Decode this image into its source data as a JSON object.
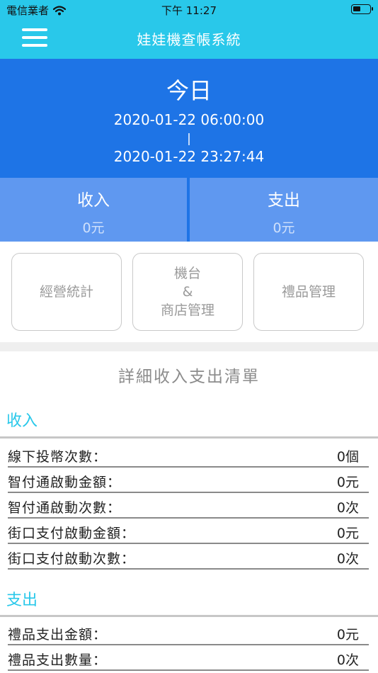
{
  "status_bar": {
    "carrier": "電信業者",
    "time": "下午 11:27",
    "icons": [
      "wifi-icon",
      "battery-icon"
    ]
  },
  "nav": {
    "title": "娃娃機查帳系統",
    "menu_icon": "hamburger-menu-icon"
  },
  "colors": {
    "topbar": "#29c8ea",
    "hero": "#1e74e6",
    "summary_cell": "#5f98f0",
    "section_title": "#29c8ea"
  },
  "period": {
    "label": "今日",
    "start": "2020-01-22 06:00:00",
    "separator": "|",
    "end": "2020-01-22 23:27:44"
  },
  "summary": {
    "income_label": "收入",
    "income_value": "0元",
    "expense_label": "支出",
    "expense_value": "0元"
  },
  "tiles": {
    "stats": "經營統計",
    "machine_line1": "機台",
    "machine_line2": "&",
    "machine_line3": "商店管理",
    "gifts": "禮品管理"
  },
  "detail": {
    "title": "詳細收入支出清單",
    "income": {
      "title": "收入",
      "items": [
        {
          "label": "線下投幣次數：",
          "value": "0個"
        },
        {
          "label": "智付通啟動金額：",
          "value": "0元"
        },
        {
          "label": "智付通啟動次數：",
          "value": "0次"
        },
        {
          "label": "街口支付啟動金額：",
          "value": "0元"
        },
        {
          "label": "街口支付啟動次數：",
          "value": "0次"
        }
      ]
    },
    "expense": {
      "title": "支出",
      "items": [
        {
          "label": "禮品支出金額：",
          "value": "0元"
        },
        {
          "label": "禮品支出數量：",
          "value": "0次"
        }
      ]
    }
  }
}
